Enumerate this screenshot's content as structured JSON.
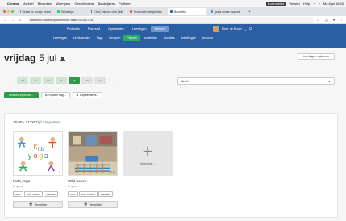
{
  "menubar": {
    "items": [
      "Chrome",
      "Archief",
      "Bewerken",
      "Weergave",
      "Geschiedenis",
      "Bladwijzers",
      "Profielen"
    ],
    "right": {
      "desktop": "Bureaublad",
      "window": "Venster",
      "help": "Help",
      "clock": "Ma 8 jul 16:53"
    }
  },
  "tabs": [
    "Betaal nu voor je bestel",
    "WhatsApp",
    "Chat | Nieuwe chat | Mic",
    "Kinderactivatieijsbeden",
    "Bandletis",
    "gratis screen capture"
  ],
  "address": {
    "url": "bandfolio.nl/admin/planner/edit?date=2024-07-05"
  },
  "primary_nav": {
    "items": [
      "Portfolios",
      "Planbord",
      "Opdrachten",
      "Leerlingen",
      "Beheer"
    ],
    "active": "Beheer"
  },
  "user": {
    "name": "Fleur de Bruijn"
  },
  "secondary_nav": {
    "items": [
      "Leerlingen",
      "Leerkrachten",
      "Tags",
      "Groepen",
      "Planner",
      "Activiteiten",
      "Locaties",
      "Instellingen",
      "Account"
    ],
    "active": "Planner"
  },
  "page": {
    "day": "vrijdag",
    "date": "5 jul",
    "print": "Leerlingen inplannen"
  },
  "days": [
    "ma",
    "di",
    "wo",
    "do",
    "vr",
    "za",
    "zo"
  ],
  "selector": {
    "value": "Ara's"
  },
  "actions": {
    "plan": "Activiteit inplannen...",
    "copy_day": "Kopieer dag...",
    "copy_week": "Kopieer week..."
  },
  "slot": {
    "time": "16:00 - 17:00",
    "edit": "Tijd aanpassen"
  },
  "cards": [
    {
      "name": "Kid's yoga",
      "age": "5+ groep",
      "badge": "0",
      "tags": [
        "Ara's",
        "BSO Kikkers",
        "Patatpan"
      ],
      "delete": "Verwijder"
    },
    {
      "name": "Wild weven",
      "age": "5+ groep",
      "badge": "0/10",
      "tags": [
        "Ara's",
        "BSO Kikkers",
        "Patatpan"
      ],
      "delete": "Verwijder"
    }
  ],
  "add": {
    "label": "Voeg toe..."
  },
  "colors": {
    "nav": "#2c5ea3",
    "active_sub": "#27ae60",
    "green_btn": "#2f9a4a"
  }
}
